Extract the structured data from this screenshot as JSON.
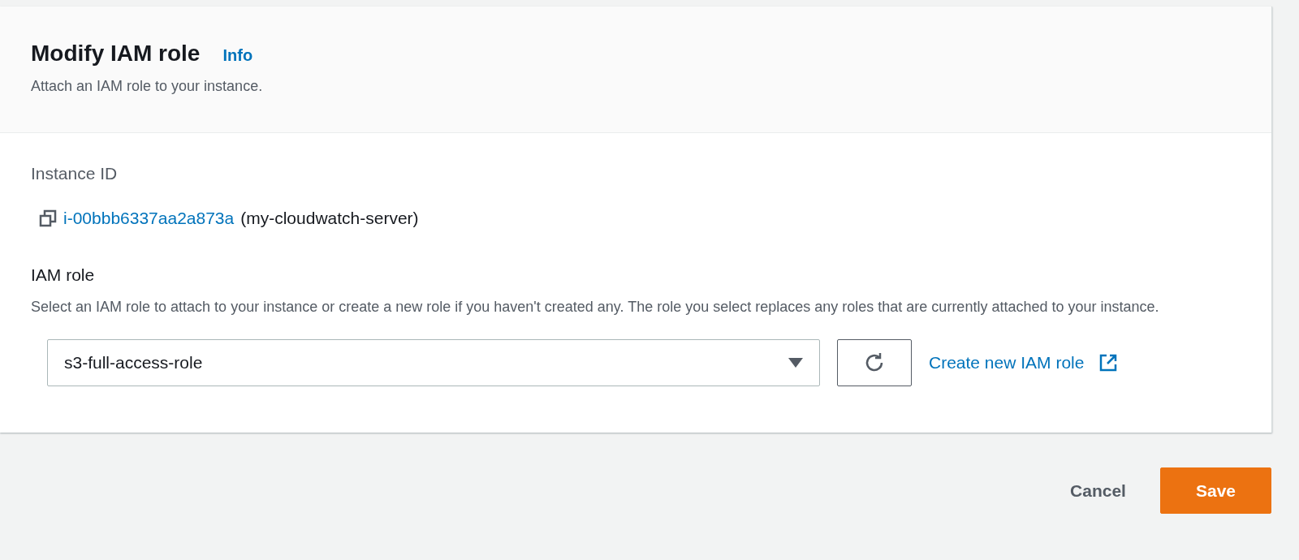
{
  "header": {
    "title": "Modify IAM role",
    "info_link": "Info",
    "description": "Attach an IAM role to your instance."
  },
  "instance": {
    "label": "Instance ID",
    "id_link": "i-00bbb6337aa2a873a",
    "name": "(my-cloudwatch-server)"
  },
  "iam_role": {
    "label": "IAM role",
    "description": "Select an IAM role to attach to your instance or create a new role if you haven't created any. The role you select replaces any roles that are currently attached to your instance.",
    "value": "s3-full-access-role",
    "create_link": "Create new IAM role"
  },
  "buttons": [
    {
      "label": "Cancel",
      "kind": "link"
    },
    {
      "label": "Save",
      "kind": "primary"
    }
  ]
}
